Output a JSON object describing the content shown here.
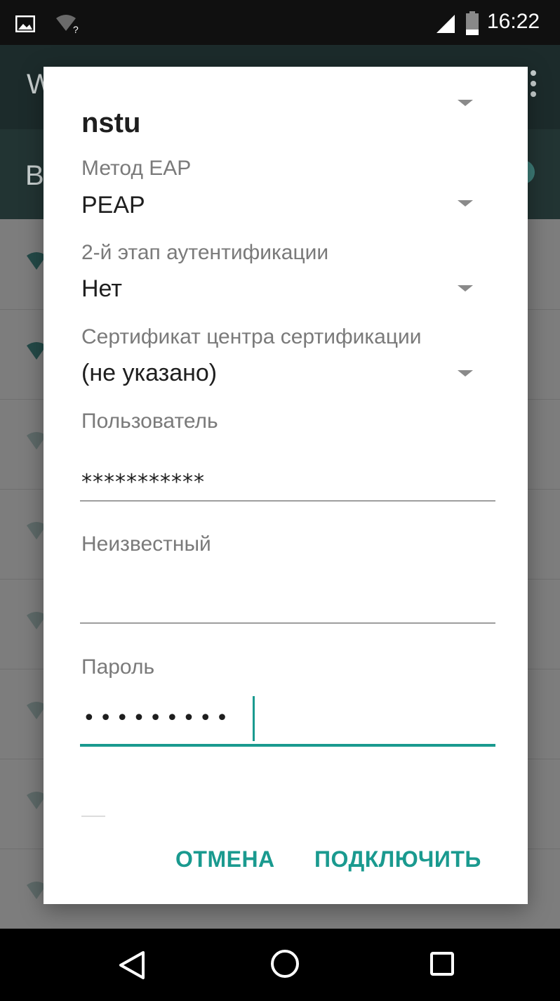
{
  "status_bar": {
    "time": "16:22",
    "icons": [
      "image-icon",
      "wifi-unknown-icon",
      "signal-icon",
      "battery-icon"
    ]
  },
  "background_app": {
    "toolbar_title": "W",
    "toggle_label": "B",
    "menu_icon": "overflow-menu-icon"
  },
  "dialog": {
    "title": "nstu",
    "eap_method": {
      "label": "Метод EAP",
      "value": "PEAP"
    },
    "phase2": {
      "label": "2-й этап аутентификации",
      "value": "Нет"
    },
    "ca_cert": {
      "label": "Сертификат центра сертификации",
      "value": "(не указано)"
    },
    "identity": {
      "label": "Пользователь",
      "value": "***********"
    },
    "anonymous": {
      "label": "Неизвестный",
      "value": ""
    },
    "password": {
      "label": "Пароль",
      "value": "•••••••••"
    },
    "buttons": {
      "cancel": "ОТМЕНА",
      "connect": "ПОДКЛЮЧИТЬ"
    }
  },
  "colors": {
    "accent": "#1a9a8f",
    "dialog_bg": "#ffffff",
    "scrim": "#7d7d7d",
    "status_bar": "#101010",
    "nav_bar": "#000000"
  },
  "nav_bar": {
    "icons": [
      "back-icon",
      "home-icon",
      "recents-icon"
    ]
  }
}
